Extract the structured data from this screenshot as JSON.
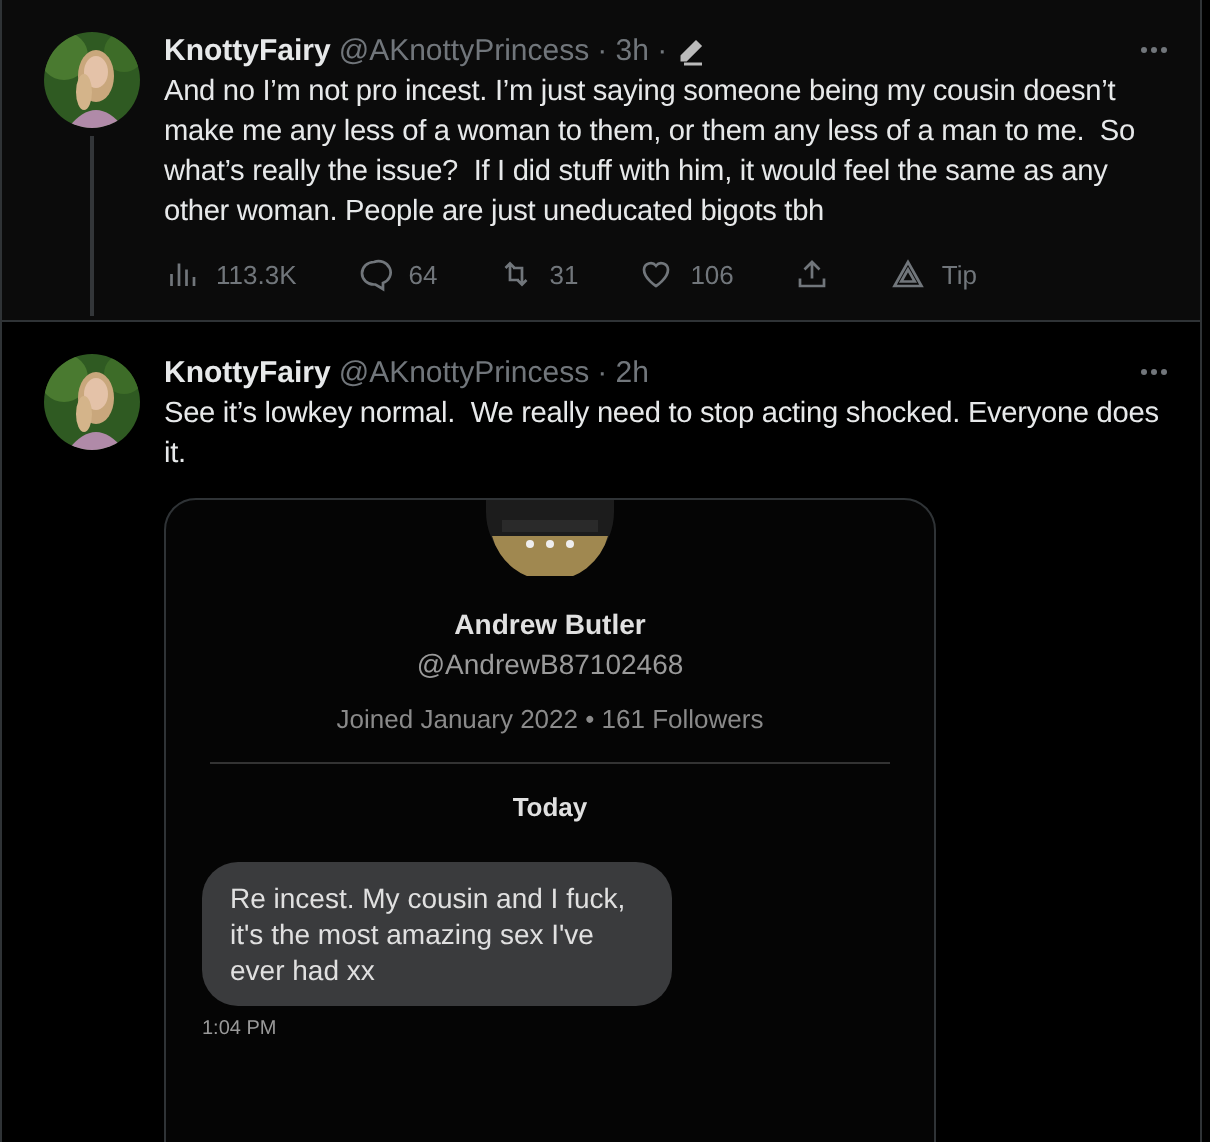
{
  "tweets": [
    {
      "name": "KnottyFairy",
      "handle": "@AKnottyPrincess",
      "time": "· 3h ·",
      "edited": true,
      "connected": true,
      "text": "And no I’m not pro incest. I’m just saying someone being my cousin doesn’t make me any less of a woman to them, or them any less of a man to me.  So what’s really the issue?  If I did stuff with him, it would feel the same as any other woman. People are just uneducated bigots tbh",
      "actions": [
        {
          "kind": "views",
          "label": "113.3K"
        },
        {
          "kind": "reply",
          "label": "64"
        },
        {
          "kind": "retweet",
          "label": "31"
        },
        {
          "kind": "like",
          "label": "106"
        },
        {
          "kind": "share"
        },
        {
          "kind": "tip",
          "label": "Tip"
        }
      ]
    },
    {
      "name": "KnottyFairy",
      "handle": "@AKnottyPrincess",
      "time": "· 2h",
      "edited": false,
      "connected": false,
      "text": "See it’s lowkey normal.  We really need to stop acting shocked. Everyone does it.",
      "media": {
        "profile_name": "Andrew Butler",
        "profile_handle": "@AndrewB87102468",
        "profile_meta": "Joined January 2022 • 161 Followers",
        "day": "Today",
        "message": "Re incest. My cousin and I fuck, it's the most amazing sex I've ever had xx",
        "message_time": "1:04 PM"
      }
    }
  ]
}
